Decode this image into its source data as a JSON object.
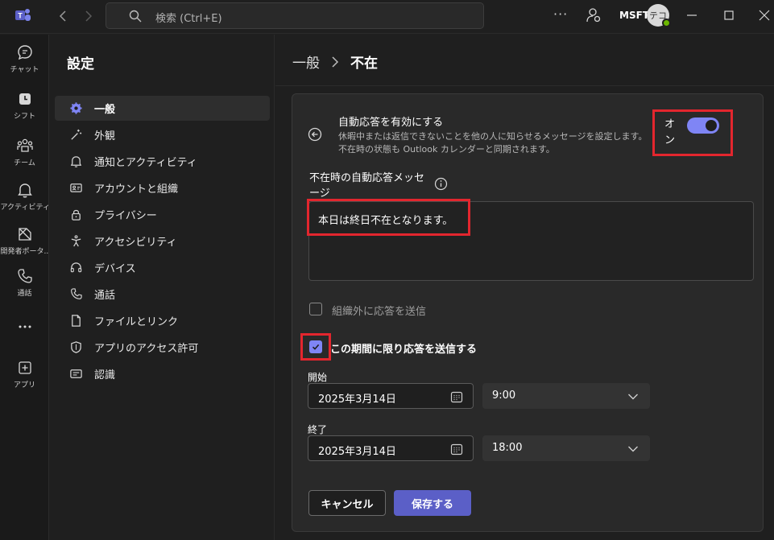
{
  "titlebar": {
    "search_placeholder": "検索 (Ctrl+E)",
    "org": "MSFT",
    "avatar_initials": "テコ"
  },
  "rail": {
    "items": [
      {
        "label": "チャット",
        "icon": "chat-icon"
      },
      {
        "label": "シフト",
        "icon": "shifts-icon"
      },
      {
        "label": "チーム",
        "icon": "teams-icon"
      },
      {
        "label": "アクティビティ",
        "icon": "bell-icon"
      },
      {
        "label": "開発者ポータ...",
        "icon": "developer-portal-icon"
      },
      {
        "label": "通話",
        "icon": "phone-icon"
      },
      {
        "label": "",
        "icon": "more-icon"
      },
      {
        "label": "アプリ",
        "icon": "apps-icon"
      }
    ]
  },
  "sidebar": {
    "title": "設定",
    "items": [
      {
        "label": "一般",
        "icon": "gear-icon"
      },
      {
        "label": "外観",
        "icon": "wand-icon"
      },
      {
        "label": "通知とアクティビティ",
        "icon": "bell-icon"
      },
      {
        "label": "アカウントと組織",
        "icon": "contact-card-icon"
      },
      {
        "label": "プライバシー",
        "icon": "lock-icon"
      },
      {
        "label": "アクセシビリティ",
        "icon": "accessibility-icon"
      },
      {
        "label": "デバイス",
        "icon": "headset-icon"
      },
      {
        "label": "通話",
        "icon": "phone-icon"
      },
      {
        "label": "ファイルとリンク",
        "icon": "document-icon"
      },
      {
        "label": "アプリのアクセス許可",
        "icon": "shield-icon"
      },
      {
        "label": "認識",
        "icon": "text-card-icon"
      }
    ]
  },
  "main": {
    "breadcrumb_parent": "一般",
    "breadcrumb_current": "不在",
    "auto_reply_title": "自動応答を有効にする",
    "auto_reply_desc": "休暇中または返信できないことを他の人に知らせるメッセージを設定します。不在時の状態も Outlook カレンダーと同期されます。",
    "toggle_label": "オン",
    "toggle_on": true,
    "message_label": "不在時の自動応答メッセージ",
    "message_value": "本日は終日不在となります。",
    "external_reply_label": "組織外に応答を送信",
    "external_reply_checked": false,
    "period_reply_label": "この期間に限り応答を送信する",
    "period_reply_checked": true,
    "start_label": "開始",
    "start_date": "2025年3月14日",
    "start_time": "9:00",
    "end_label": "終了",
    "end_date": "2025年3月14日",
    "end_time": "18:00",
    "cancel_label": "キャンセル",
    "save_label": "保存する"
  },
  "colors": {
    "accent": "#7f85f5",
    "primary_button": "#5b5fc7",
    "highlight_box": "#e3262e"
  }
}
